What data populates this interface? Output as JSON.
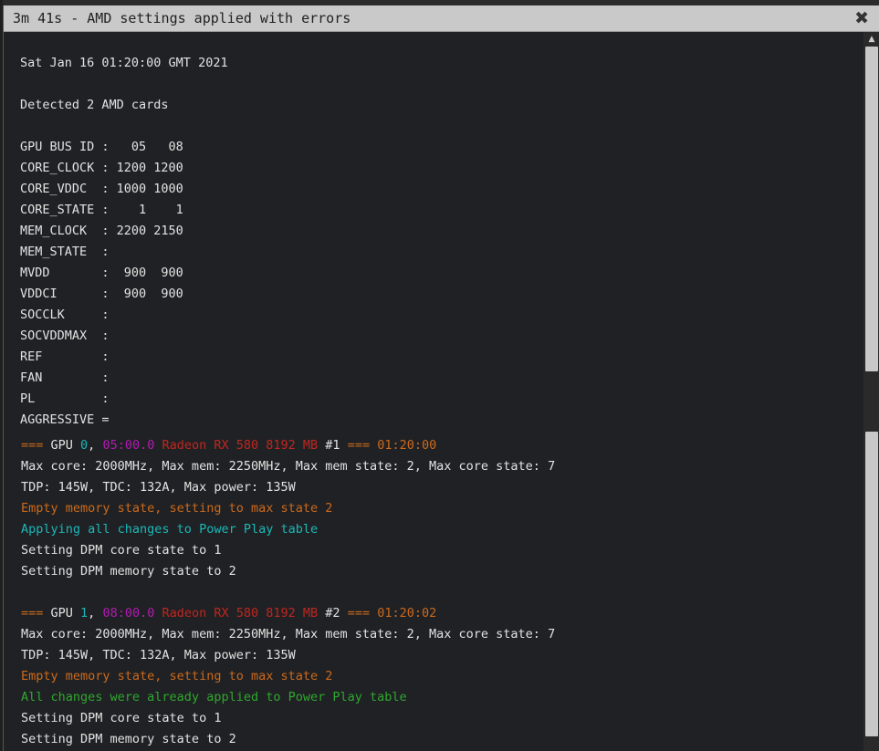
{
  "window": {
    "title": "3m 41s - AMD settings applied with errors",
    "close_glyph": "✖"
  },
  "log": {
    "date": "Sat Jan 16 01:20:00 GMT 2021",
    "detected": "Detected 2 AMD cards",
    "table": [
      "GPU BUS ID :   05   08",
      "CORE_CLOCK : 1200 1200",
      "CORE_VDDC  : 1000 1000",
      "CORE_STATE :    1    1",
      "MEM_CLOCK  : 2200 2150",
      "MEM_STATE  :",
      "MVDD       :  900  900",
      "VDDCI      :  900  900",
      "SOCCLK     :",
      "SOCVDDMAX  :",
      "REF        :",
      "FAN        :",
      "PL         :",
      "AGGRESSIVE ="
    ],
    "gpus": [
      {
        "header_prefix": "=== ",
        "gpu_word": "GPU ",
        "index": "0",
        "comma": ", ",
        "bus": "05:00.0",
        "space": " ",
        "model": "Radeon RX 580 8192 MB",
        "num": " #1 ",
        "sep": "=== ",
        "time": "01:20:00",
        "max_line": "Max core: 2000MHz, Max mem: 2250MHz, Max mem state: 2, Max core state: 7",
        "tdp_line": "TDP: 145W, TDC: 132A, Max power: 135W",
        "warn_line": "Empty memory state, setting to max state 2",
        "apply_line": "Applying all changes to Power Play table",
        "core_line": "Setting DPM core state to 1",
        "mem_line": "Setting DPM memory state to 2"
      },
      {
        "header_prefix": "=== ",
        "gpu_word": "GPU ",
        "index": "1",
        "comma": ", ",
        "bus": "08:00.0",
        "space": " ",
        "model": "Radeon RX 580 8192 MB",
        "num": " #2 ",
        "sep": "=== ",
        "time": "01:20:02",
        "max_line": "Max core: 2000MHz, Max mem: 2250MHz, Max mem state: 2, Max core state: 7",
        "tdp_line": "TDP: 145W, TDC: 132A, Max power: 135W",
        "warn_line": "Empty memory state, setting to max state 2",
        "apply_line": "All changes were already applied to Power Play table",
        "core_line": "Setting DPM core state to 1",
        "mem_line": "Setting DPM memory state to 2"
      }
    ]
  },
  "colors": {
    "orange": "#cc6a1c",
    "cyan": "#1bb8b8",
    "magenta": "#b31ab3",
    "red": "#c0261f",
    "green": "#2ea82e"
  },
  "scrollbar": {
    "up_glyph": "▲"
  }
}
